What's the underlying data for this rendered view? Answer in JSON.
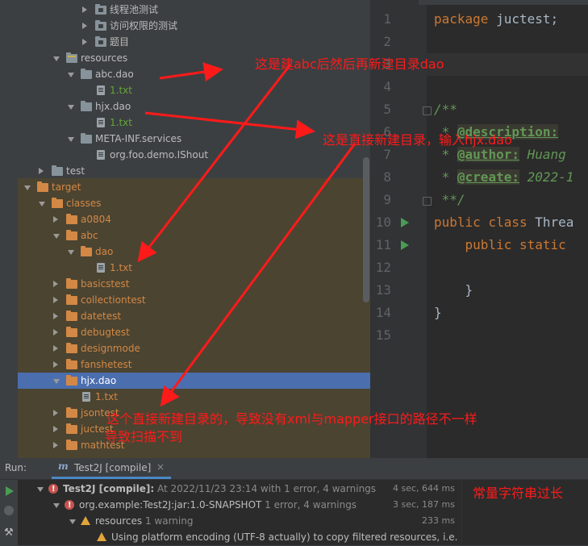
{
  "project_tree": {
    "items": [
      {
        "label": "线程池测试",
        "depth": 4,
        "expanded": false,
        "icon": "package-folder-icon"
      },
      {
        "label": "访问权限的测试",
        "depth": 4,
        "expanded": false,
        "icon": "package-folder-icon"
      },
      {
        "label": "题目",
        "depth": 4,
        "expanded": false,
        "icon": "package-folder-icon"
      },
      {
        "label": "resources",
        "depth": 2,
        "expanded": true,
        "icon": "resources-folder-icon"
      },
      {
        "label": "abc.dao",
        "depth": 3,
        "expanded": true,
        "icon": "folder-icon"
      },
      {
        "label": "1.txt",
        "depth": 4,
        "icon": "text-file-icon",
        "color": "green"
      },
      {
        "label": "hjx.dao",
        "depth": 3,
        "expanded": true,
        "icon": "folder-icon"
      },
      {
        "label": "1.txt",
        "depth": 4,
        "icon": "text-file-icon",
        "color": "green"
      },
      {
        "label": "META-INF.services",
        "depth": 3,
        "expanded": true,
        "icon": "folder-icon"
      },
      {
        "label": "org.foo.demo.IShout",
        "depth": 4,
        "icon": "text-file-icon"
      },
      {
        "label": "test",
        "depth": 1,
        "expanded": false,
        "icon": "folder-icon"
      },
      {
        "label": "target",
        "depth": 0,
        "expanded": true,
        "icon": "orange-folder-icon",
        "color": "orange"
      },
      {
        "label": "classes",
        "depth": 1,
        "expanded": true,
        "icon": "orange-folder-icon",
        "color": "orange"
      },
      {
        "label": "a0804",
        "depth": 2,
        "expanded": false,
        "icon": "orange-folder-icon",
        "color": "orange"
      },
      {
        "label": "abc",
        "depth": 2,
        "expanded": true,
        "icon": "orange-folder-icon",
        "color": "orange"
      },
      {
        "label": "dao",
        "depth": 3,
        "expanded": true,
        "icon": "orange-folder-icon",
        "color": "orange"
      },
      {
        "label": "1.txt",
        "depth": 4,
        "icon": "text-file-icon",
        "color": "orange"
      },
      {
        "label": "basicstest",
        "depth": 2,
        "expanded": false,
        "icon": "orange-folder-icon",
        "color": "orange"
      },
      {
        "label": "collectiontest",
        "depth": 2,
        "expanded": false,
        "icon": "orange-folder-icon",
        "color": "orange"
      },
      {
        "label": "datetest",
        "depth": 2,
        "expanded": false,
        "icon": "orange-folder-icon",
        "color": "orange"
      },
      {
        "label": "debugtest",
        "depth": 2,
        "expanded": false,
        "icon": "orange-folder-icon",
        "color": "orange"
      },
      {
        "label": "designmode",
        "depth": 2,
        "expanded": false,
        "icon": "orange-folder-icon",
        "color": "orange"
      },
      {
        "label": "fanshetest",
        "depth": 2,
        "expanded": false,
        "icon": "orange-folder-icon",
        "color": "orange"
      },
      {
        "label": "hjx.dao",
        "depth": 2,
        "expanded": true,
        "icon": "orange-folder-icon",
        "color": "orange",
        "selected": true
      },
      {
        "label": "1.txt",
        "depth": 3,
        "icon": "text-file-icon",
        "color": "orange"
      },
      {
        "label": "jsontest",
        "depth": 2,
        "expanded": false,
        "icon": "orange-folder-icon",
        "color": "orange"
      },
      {
        "label": "juctest",
        "depth": 2,
        "expanded": false,
        "icon": "orange-folder-icon",
        "color": "orange"
      },
      {
        "label": "mathtest",
        "depth": 2,
        "expanded": false,
        "icon": "orange-folder-icon",
        "color": "orange"
      }
    ]
  },
  "editor": {
    "line_numbers": [
      "1",
      "2",
      "3",
      "4",
      "5",
      "6",
      "7",
      "8",
      "9",
      "10",
      "11",
      "12",
      "13",
      "14",
      "15"
    ],
    "code": {
      "l1_kw": "package",
      "l1_rest": " juctest;",
      "l5": "/**",
      "l6_star": " * ",
      "l6_tag": "@description:",
      "l7_star": " * ",
      "l7_tag": "@author:",
      "l7_val": " Huang",
      "l8_star": " * ",
      "l8_tag": "@create:",
      "l8_val": " 2022-1",
      "l9": " **/",
      "l10_kw": "public class",
      "l10_rest": " Threa",
      "l11_kw": "    public static",
      "l13": "    }",
      "l14": "}"
    }
  },
  "annotations": {
    "note1": "这是建abc后然后再新建目录dao",
    "note2": "这是直接新建目录，输入hjx.dao",
    "note3_line1": "这个直接新建目录的，导致没有xml与mapper接口的路径不一样",
    "note3_line2": "导致扫描不到",
    "note4": "常量字符串过长",
    "color": "#ff1a1a"
  },
  "run_panel": {
    "title": "Run:",
    "tab_label": "Test2J [compile]",
    "rows": [
      {
        "bold": "Test2J [compile]:",
        "text": " At 2022/11/23 23:14 with 1 error, 4 warnings",
        "time": "4 sec, 644 ms",
        "icon": "error-icon"
      },
      {
        "bold": "",
        "text": "org.example:Test2J:jar:1.0-SNAPSHOT",
        "extra": "  1 error, 4 warnings",
        "time": "3 sec, 187 ms",
        "icon": "error-icon"
      },
      {
        "bold": "",
        "text": "resources",
        "extra": "  1 warning",
        "time": "233 ms",
        "icon": "warning-icon"
      },
      {
        "bold": "",
        "text": "Using platform encoding (UTF-8 actually) to copy filtered resources, i.e.",
        "time": "",
        "icon": "warning-icon"
      }
    ]
  }
}
